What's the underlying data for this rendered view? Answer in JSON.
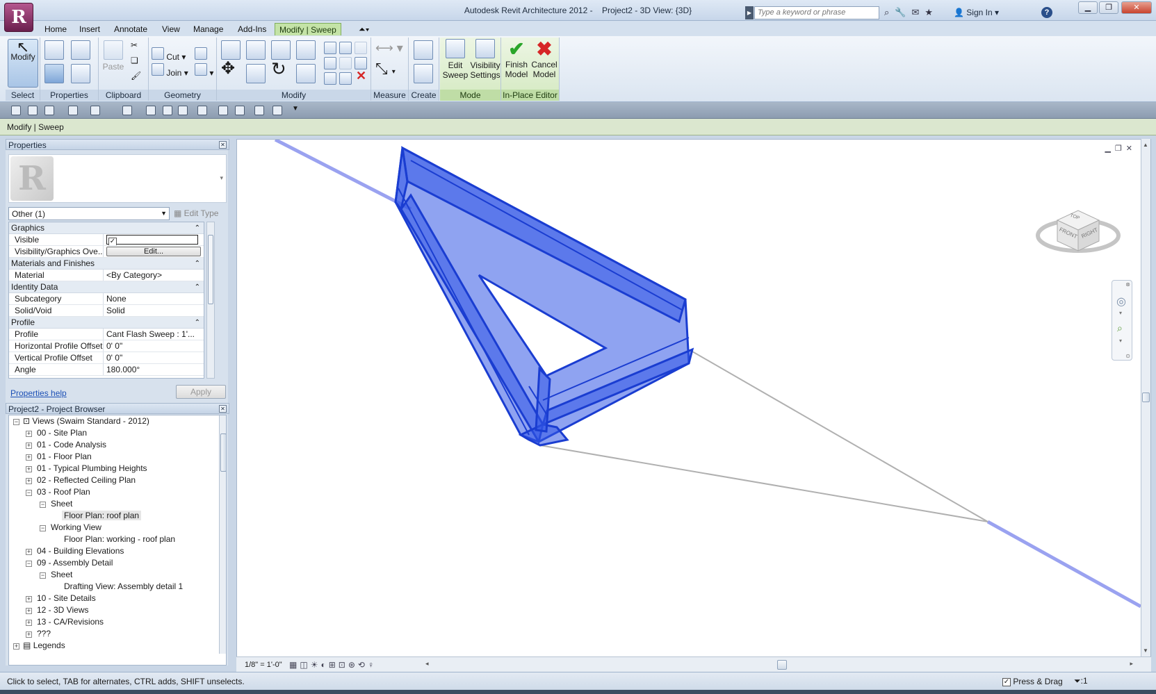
{
  "window": {
    "title": "Autodesk Revit Architecture 2012 -",
    "view_title": "Project2 - 3D View: {3D}",
    "search_placeholder": "Type a keyword or phrase",
    "sign_in": "Sign In"
  },
  "tabs": [
    {
      "label": "Home"
    },
    {
      "label": "Insert"
    },
    {
      "label": "Annotate"
    },
    {
      "label": "View"
    },
    {
      "label": "Manage"
    },
    {
      "label": "Add-Ins"
    },
    {
      "label": "Modify | Sweep"
    }
  ],
  "ribbon": {
    "panels": {
      "select": "Select",
      "properties": "Properties",
      "clipboard": "Clipboard",
      "geometry": "Geometry",
      "modify": "Modify",
      "measure": "Measure",
      "create": "Create",
      "mode": "Mode",
      "in_place_editor": "In-Place Editor"
    },
    "buttons": {
      "modify": "Modify",
      "paste": "Paste",
      "cut": "Cut",
      "join": "Join",
      "edit_sweep_1": "Edit",
      "edit_sweep_2": "Sweep",
      "visibility_1": "Visibility",
      "visibility_2": "Settings",
      "finish_1": "Finish",
      "finish_2": "Model",
      "cancel_1": "Cancel",
      "cancel_2": "Model"
    }
  },
  "options_bar": {
    "label": "Modify | Sweep"
  },
  "properties_panel": {
    "title": "Properties",
    "type_selector": "Other (1)",
    "edit_type": "Edit Type",
    "sections": [
      {
        "name": "Graphics",
        "rows": [
          {
            "name": "Visible",
            "value": ""
          },
          {
            "name": "Visibility/Graphics Ove...",
            "value": "Edit..."
          }
        ]
      },
      {
        "name": "Materials and Finishes",
        "rows": [
          {
            "name": "Material",
            "value": "<By Category>"
          }
        ]
      },
      {
        "name": "Identity Data",
        "rows": [
          {
            "name": "Subcategory",
            "value": "None"
          },
          {
            "name": "Solid/Void",
            "value": "Solid"
          }
        ]
      },
      {
        "name": "Profile",
        "rows": [
          {
            "name": "Profile",
            "value": "Cant Flash Sweep : 1'..."
          },
          {
            "name": "Horizontal Profile Offset",
            "value": "0'  0\""
          },
          {
            "name": "Vertical Profile Offset",
            "value": "0'  0\""
          },
          {
            "name": "Angle",
            "value": "180.000°"
          }
        ]
      }
    ],
    "help_link": "Properties help",
    "apply": "Apply"
  },
  "project_browser": {
    "title": "Project2 - Project Browser",
    "items": [
      {
        "label": "Views (Swaim Standard - 2012)"
      },
      {
        "label": "00 - Site Plan"
      },
      {
        "label": "01 - Code Analysis"
      },
      {
        "label": "01 - Floor Plan"
      },
      {
        "label": "01 - Typical Plumbing Heights"
      },
      {
        "label": "02 - Reflected Ceiling Plan"
      },
      {
        "label": "03 - Roof Plan"
      },
      {
        "label": "Sheet"
      },
      {
        "label": "Floor Plan: roof plan"
      },
      {
        "label": "Working View"
      },
      {
        "label": "Floor Plan: working -  roof plan"
      },
      {
        "label": "04 - Building Elevations"
      },
      {
        "label": "09 - Assembly Detail"
      },
      {
        "label": "Sheet"
      },
      {
        "label": "Drafting View: Assembly detail 1"
      },
      {
        "label": "10 - Site Details"
      },
      {
        "label": "12 - 3D Views"
      },
      {
        "label": "13 - CA/Revisions"
      },
      {
        "label": "???"
      },
      {
        "label": "Legends"
      }
    ]
  },
  "view_bar": {
    "scale": "1/8\" = 1'-0\""
  },
  "viewcube": {
    "top": "TOP",
    "front": "FRONT",
    "right": "RIGHT"
  },
  "status_bar": {
    "hint": "Click to select, TAB for alternates, CTRL adds, SHIFT unselects.",
    "press_drag": "Press & Drag",
    "filter_count": ":1"
  },
  "colors": {
    "selection_blue": "#1f4fd1",
    "ribbon_green": "#c4e3a7",
    "cancel_red": "#d62626",
    "finish_green": "#2aa52a"
  }
}
